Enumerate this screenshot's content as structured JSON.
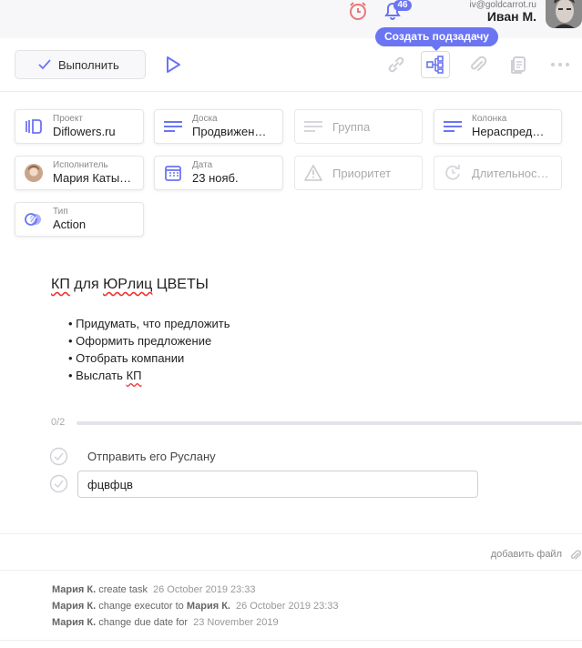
{
  "header": {
    "notifications_count": "46",
    "user_email": "iv@goldcarrot.ru",
    "user_name": "Иван М.",
    "icons": [
      "timer-icon",
      "bell-icon",
      "user-avatar"
    ]
  },
  "toolbar": {
    "complete_label": "Выполнить",
    "tooltip": "Создать подзадачу",
    "icons": [
      "play-icon",
      "link-icon",
      "subtask-tree-icon",
      "attach-icon",
      "copy-icon",
      "more-icon"
    ]
  },
  "fields": {
    "project": {
      "label": "Проект",
      "value": "Diflowers.ru",
      "icon": "project-icon"
    },
    "board": {
      "label": "Доска",
      "value": "Продвижен…",
      "icon": "board-lines-icon"
    },
    "group": {
      "placeholder": "Группа",
      "icon": "group-lines-icon"
    },
    "column": {
      "label": "Колонка",
      "value": "Нераспред…",
      "icon": "column-lines-icon"
    },
    "executor": {
      "label": "Исполнитель",
      "value": "Мария Каты…",
      "icon": "executor-avatar"
    },
    "date": {
      "label": "Дата",
      "value": "23 нояб.",
      "icon": "calendar-icon"
    },
    "priority": {
      "placeholder": "Приоритет",
      "icon": "warning-icon"
    },
    "duration": {
      "placeholder": "Длительнос…",
      "icon": "duration-icon"
    },
    "type": {
      "label": "Тип",
      "value": "Action",
      "icon": "type-icon"
    }
  },
  "description": {
    "title_pre": "КП",
    "title_mid": " для ",
    "title_word": "ЮРлиц",
    "title_post": " ЦВЕТЫ",
    "bullets": [
      "Придумать, что предложить",
      "Оформить предложение",
      "Отобрать компании"
    ],
    "last_bullet_pre": "Выслать ",
    "last_bullet_word": "КП"
  },
  "checklist": {
    "progress_text": "0/2",
    "progress_fraction": 0,
    "items": [
      "Отправить его Руслану"
    ],
    "input_value": "фцвфцв"
  },
  "attachments": {
    "add_file_label": "добавить файл"
  },
  "activity": [
    {
      "user": "Мария К.",
      "action": " create task",
      "time": "26 October 2019 23:33"
    },
    {
      "user": "Мария К.",
      "action": " change executor to ",
      "target": "Мария К.",
      "time": "26 October 2019 23:33"
    },
    {
      "user": "Мария К.",
      "action": " change due date for",
      "time": "23 November 2019"
    }
  ],
  "colors": {
    "accent": "#6b74f3",
    "timer": "#e9787a",
    "border": "#e6e6ea"
  }
}
